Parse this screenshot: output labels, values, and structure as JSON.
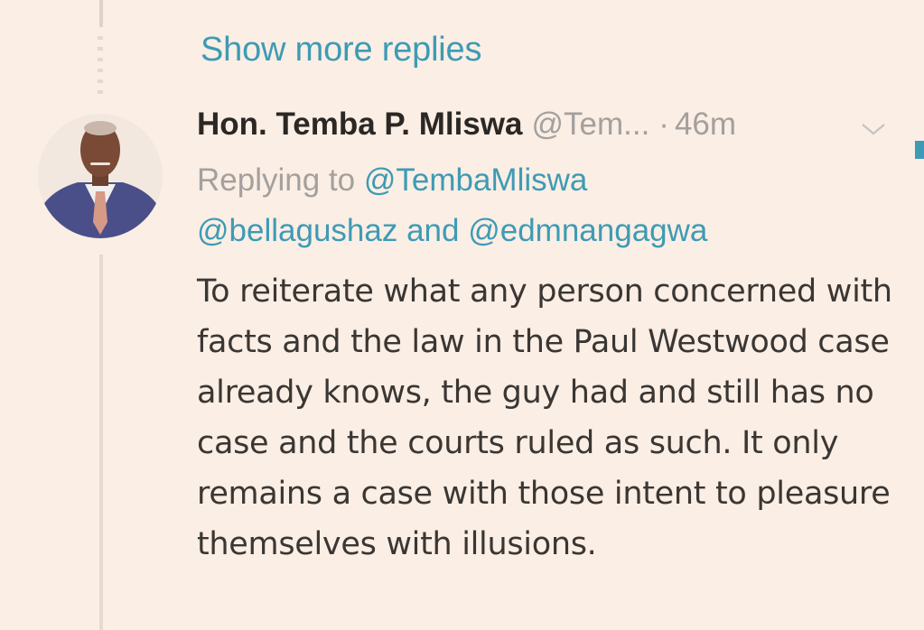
{
  "thread": {
    "show_more_label": "Show more replies"
  },
  "tweet": {
    "author_name": "Hon. Temba P. Mliswa",
    "author_handle": "@Tem...",
    "separator": "·",
    "timestamp": "46m",
    "reply_prefix": "Replying to",
    "reply_mention_1": "@TembaMliswa",
    "reply_mention_2": "@bellagushaz",
    "reply_and": "and",
    "reply_mention_3": "@edmnangagwa",
    "body": "To reiterate what any person concerned with facts and the law in the Paul Westwood case already knows, the guy had and still has no case and the courts ruled as such. It only remains a case with those intent to pleasure themselves with illusions."
  },
  "icons": {
    "avatar": "profile-photo",
    "caret": "chevron-down-icon"
  },
  "colors": {
    "background": "#fbeee4",
    "link": "#3d9bb5",
    "muted": "#a3a09e",
    "text": "#3a3633"
  }
}
